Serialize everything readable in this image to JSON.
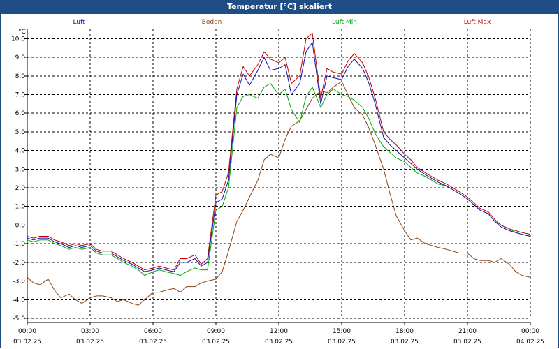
{
  "window": {
    "title": "Temperatur [°C] skaliert"
  },
  "chart_data": {
    "type": "line",
    "title": "Temperatur [°C] skaliert",
    "ylabel": "°C",
    "ylim": [
      -5.0,
      10.5
    ],
    "yticks": [
      "10,0",
      "9,0",
      "8,0",
      "7,0",
      "6,0",
      "5,0",
      "4,0",
      "3,0",
      "2,0",
      "1,0",
      "0,0",
      "-1,0",
      "-2,0",
      "-3,0",
      "-4,0",
      "-5,0"
    ],
    "ytick_values": [
      10,
      9,
      8,
      7,
      6,
      5,
      4,
      3,
      2,
      1,
      0,
      -1,
      -2,
      -3,
      -4,
      -5
    ],
    "xticks": [
      {
        "time": "00:00",
        "date": "03.02.25"
      },
      {
        "time": "03:00",
        "date": "03.02.25"
      },
      {
        "time": "06:00",
        "date": "03.02.25"
      },
      {
        "time": "09:00",
        "date": "03.02.25"
      },
      {
        "time": "12:00",
        "date": "03.02.25"
      },
      {
        "time": "15:00",
        "date": "03.02.25"
      },
      {
        "time": "18:00",
        "date": "03.02.25"
      },
      {
        "time": "21:00",
        "date": "03.02.25"
      },
      {
        "time": "00:00",
        "date": "04.02.25"
      }
    ],
    "xtick_hours": [
      0,
      3,
      6,
      9,
      12,
      15,
      18,
      21,
      24
    ],
    "grid": true,
    "legend_position": "top",
    "series": [
      {
        "name": "Boden",
        "color": "#8b4513",
        "x": [
          0,
          0.3,
          0.6,
          1.0,
          1.3,
          1.6,
          2.0,
          2.3,
          2.6,
          3.0,
          3.3,
          3.6,
          4.0,
          4.3,
          4.6,
          5.0,
          5.3,
          5.6,
          6.0,
          6.3,
          6.6,
          7.0,
          7.3,
          7.6,
          8.0,
          8.3,
          8.6,
          9.0,
          9.3,
          9.6,
          10.0,
          10.3,
          10.6,
          11.0,
          11.3,
          11.6,
          12.0,
          12.3,
          12.6,
          13.0,
          13.3,
          13.6,
          14.0,
          14.3,
          14.6,
          15.0,
          15.3,
          15.6,
          16.0,
          16.3,
          16.6,
          17.0,
          17.3,
          17.6,
          18.0,
          18.3,
          18.6,
          19.0,
          19.3,
          19.6,
          20.0,
          20.3,
          20.6,
          21.0,
          21.3,
          21.6,
          22.0,
          22.3,
          22.6,
          23.0,
          23.3,
          23.6,
          24.0
        ],
        "y": [
          -2.8,
          -3.1,
          -3.2,
          -2.9,
          -3.5,
          -3.9,
          -3.7,
          -4.0,
          -4.2,
          -3.9,
          -3.8,
          -3.8,
          -3.9,
          -4.1,
          -4.0,
          -4.2,
          -4.3,
          -4.0,
          -3.6,
          -3.6,
          -3.5,
          -3.4,
          -3.6,
          -3.3,
          -3.3,
          -3.1,
          -3.0,
          -2.9,
          -2.5,
          -1.4,
          0.2,
          0.8,
          1.5,
          2.4,
          3.5,
          3.8,
          3.6,
          4.6,
          5.3,
          5.6,
          6.2,
          6.8,
          7.2,
          7.1,
          7.4,
          7.7,
          7.0,
          6.3,
          5.9,
          5.2,
          4.3,
          3.0,
          1.7,
          0.5,
          -0.3,
          -0.8,
          -0.7,
          -1.0,
          -1.1,
          -1.2,
          -1.3,
          -1.4,
          -1.5,
          -1.5,
          -1.8,
          -1.9,
          -1.9,
          -2.0,
          -1.8,
          -2.1,
          -2.5,
          -2.7,
          -2.8
        ]
      },
      {
        "name": "Luft Min",
        "color": "#00a800",
        "x": [
          0,
          0.3,
          0.6,
          1.0,
          1.3,
          1.6,
          2.0,
          2.3,
          2.6,
          3.0,
          3.3,
          3.6,
          4.0,
          4.3,
          4.6,
          5.0,
          5.3,
          5.6,
          6.0,
          6.3,
          6.6,
          7.0,
          7.3,
          7.6,
          8.0,
          8.3,
          8.6,
          9.0,
          9.3,
          9.6,
          10.0,
          10.3,
          10.6,
          11.0,
          11.3,
          11.6,
          12.0,
          12.3,
          12.6,
          13.0,
          13.3,
          13.6,
          14.0,
          14.3,
          14.6,
          15.0,
          15.3,
          15.6,
          16.0,
          16.3,
          16.6,
          17.0,
          17.3,
          17.6,
          18.0,
          18.3,
          18.6,
          19.0,
          19.3,
          19.6,
          20.0,
          20.3,
          20.6,
          21.0,
          21.3,
          21.6,
          22.0,
          22.3,
          22.6,
          23.0,
          23.3,
          23.6,
          24.0
        ],
        "y": [
          -0.8,
          -0.9,
          -0.8,
          -0.8,
          -1.0,
          -1.1,
          -1.3,
          -1.2,
          -1.3,
          -1.2,
          -1.5,
          -1.6,
          -1.6,
          -1.8,
          -2.0,
          -2.2,
          -2.4,
          -2.7,
          -2.5,
          -2.4,
          -2.5,
          -2.6,
          -2.7,
          -2.5,
          -2.3,
          -2.4,
          -2.4,
          0.8,
          1.0,
          2.0,
          6.3,
          6.9,
          7.0,
          6.8,
          7.4,
          7.6,
          7.0,
          7.3,
          6.2,
          5.5,
          6.9,
          7.4,
          6.3,
          7.0,
          7.3,
          7.0,
          6.9,
          6.7,
          6.3,
          5.7,
          4.9,
          4.2,
          3.9,
          3.6,
          3.4,
          3.1,
          2.8,
          2.6,
          2.4,
          2.2,
          2.1,
          1.9,
          1.7,
          1.4,
          1.1,
          0.8,
          0.6,
          0.2,
          0.0,
          -0.2,
          -0.4,
          -0.5,
          -0.6
        ]
      },
      {
        "name": "Luft Max",
        "color": "#c00000",
        "x": [
          0,
          0.3,
          0.6,
          1.0,
          1.3,
          1.6,
          2.0,
          2.3,
          2.6,
          3.0,
          3.3,
          3.6,
          4.0,
          4.3,
          4.6,
          5.0,
          5.3,
          5.6,
          6.0,
          6.3,
          6.6,
          7.0,
          7.3,
          7.6,
          8.0,
          8.3,
          8.6,
          9.0,
          9.3,
          9.6,
          10.0,
          10.3,
          10.6,
          11.0,
          11.3,
          11.6,
          12.0,
          12.3,
          12.6,
          13.0,
          13.3,
          13.6,
          14.0,
          14.3,
          14.6,
          15.0,
          15.3,
          15.6,
          16.0,
          16.3,
          16.6,
          17.0,
          17.3,
          17.6,
          18.0,
          18.3,
          18.6,
          19.0,
          19.3,
          19.6,
          20.0,
          20.3,
          20.6,
          21.0,
          21.3,
          21.6,
          22.0,
          22.3,
          22.6,
          23.0,
          23.3,
          23.6,
          24.0
        ],
        "y": [
          -0.6,
          -0.7,
          -0.6,
          -0.6,
          -0.8,
          -0.9,
          -1.1,
          -1.0,
          -1.1,
          -1.0,
          -1.3,
          -1.4,
          -1.4,
          -1.6,
          -1.8,
          -2.0,
          -2.2,
          -2.4,
          -2.3,
          -2.2,
          -2.3,
          -2.4,
          -1.8,
          -1.8,
          -1.6,
          -2.1,
          -1.8,
          1.6,
          1.8,
          2.8,
          7.3,
          8.5,
          8.0,
          8.6,
          9.3,
          8.9,
          8.7,
          9.0,
          7.6,
          8.0,
          10.0,
          10.3,
          6.8,
          8.4,
          8.2,
          8.1,
          8.8,
          9.2,
          8.7,
          7.9,
          6.8,
          5.0,
          4.6,
          4.3,
          3.8,
          3.5,
          3.1,
          2.8,
          2.6,
          2.4,
          2.2,
          2.0,
          1.8,
          1.5,
          1.2,
          0.9,
          0.7,
          0.3,
          0.0,
          -0.2,
          -0.3,
          -0.4,
          -0.5
        ]
      },
      {
        "name": "Luft",
        "color": "#1010b0",
        "x": [
          0,
          0.3,
          0.6,
          1.0,
          1.3,
          1.6,
          2.0,
          2.3,
          2.6,
          3.0,
          3.3,
          3.6,
          4.0,
          4.3,
          4.6,
          5.0,
          5.3,
          5.6,
          6.0,
          6.3,
          6.6,
          7.0,
          7.3,
          7.6,
          8.0,
          8.3,
          8.6,
          9.0,
          9.3,
          9.6,
          10.0,
          10.3,
          10.6,
          11.0,
          11.3,
          11.6,
          12.0,
          12.3,
          12.6,
          13.0,
          13.3,
          13.6,
          14.0,
          14.3,
          14.6,
          15.0,
          15.3,
          15.6,
          16.0,
          16.3,
          16.6,
          17.0,
          17.3,
          17.6,
          18.0,
          18.3,
          18.6,
          19.0,
          19.3,
          19.6,
          20.0,
          20.3,
          20.6,
          21.0,
          21.3,
          21.6,
          22.0,
          22.3,
          22.6,
          23.0,
          23.3,
          23.6,
          24.0
        ],
        "y": [
          -0.7,
          -0.8,
          -0.7,
          -0.7,
          -0.9,
          -1.0,
          -1.2,
          -1.1,
          -1.2,
          -1.1,
          -1.4,
          -1.5,
          -1.5,
          -1.7,
          -1.9,
          -2.1,
          -2.3,
          -2.5,
          -2.4,
          -2.3,
          -2.4,
          -2.5,
          -2.0,
          -2.0,
          -1.8,
          -2.2,
          -2.0,
          1.2,
          1.4,
          2.4,
          7.0,
          8.1,
          7.5,
          8.3,
          9.0,
          8.3,
          8.4,
          8.6,
          7.0,
          7.6,
          9.3,
          9.8,
          6.5,
          8.0,
          7.9,
          7.8,
          8.5,
          8.9,
          8.4,
          7.6,
          6.5,
          4.7,
          4.3,
          4.0,
          3.6,
          3.3,
          3.0,
          2.7,
          2.5,
          2.3,
          2.1,
          1.9,
          1.7,
          1.4,
          1.1,
          0.8,
          0.6,
          0.2,
          -0.1,
          -0.3,
          -0.4,
          -0.5,
          -0.6
        ]
      }
    ],
    "legend": [
      {
        "name": "Luft",
        "color": "#1010b0"
      },
      {
        "name": "Boden",
        "color": "#8b4513"
      },
      {
        "name": "Luft Min",
        "color": "#00a800"
      },
      {
        "name": "Luft Max",
        "color": "#c00000"
      }
    ]
  }
}
